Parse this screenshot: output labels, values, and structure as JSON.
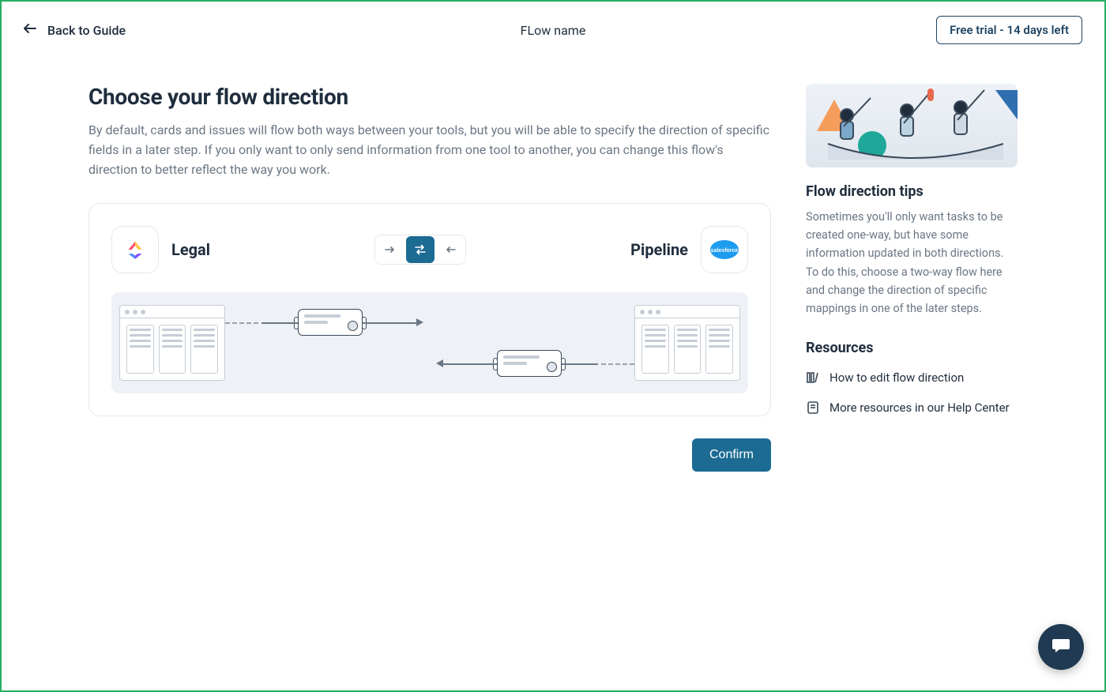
{
  "header": {
    "back_label": "Back to Guide",
    "flow_name": "FLow name",
    "trial_label": "Free trial - 14 days left"
  },
  "main": {
    "title": "Choose your flow direction",
    "description": "By default, cards and issues will flow both ways between your tools, but you will be able to specify the direction of specific fields in a later step. If you only want to only send information from one tool to another, you can change this flow's direction to better reflect the way you work.",
    "left_tool": "Legal",
    "right_tool": "Pipeline",
    "direction_options": [
      "one-way-right",
      "two-way",
      "one-way-left"
    ],
    "direction_selected": "two-way",
    "confirm_label": "Confirm"
  },
  "sidebar": {
    "tips_title": "Flow direction tips",
    "tips_body": "Sometimes you'll only want tasks to be created one-way, but have some information updated in both directions. To do this, choose a two-way flow here and change the direction of specific mappings in one of the later steps.",
    "resources_title": "Resources",
    "resources": [
      {
        "icon": "library-icon",
        "label": "How to edit flow direction"
      },
      {
        "icon": "book-icon",
        "label": "More resources in our Help Center"
      }
    ]
  }
}
